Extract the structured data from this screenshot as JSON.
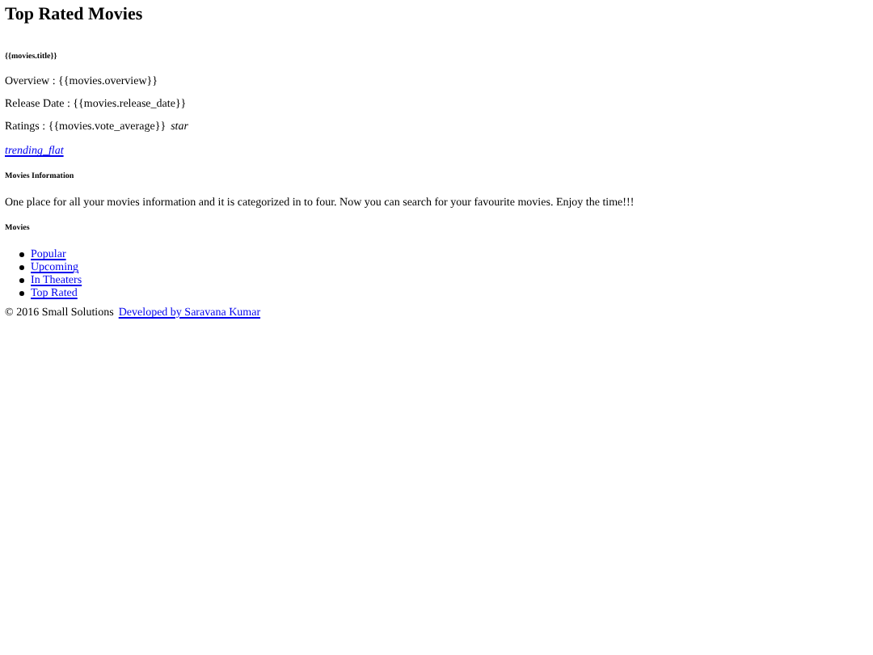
{
  "page_title": "Top Rated Movies",
  "movie": {
    "title": "{{movies.title}}",
    "overview": "Overview : {{movies.overview}}",
    "release_date": "Release Date : {{movies.release_date}}",
    "ratings": "Ratings : {{movies.vote_average}}",
    "ratings_icon": "star",
    "link": "trending_flat"
  },
  "info": {
    "heading": "Movies Information",
    "text": "One place for all your movies information and it is categorized in to four. Now you can search for your favourite movies. Enjoy the time!!!"
  },
  "nav": {
    "heading": "Movies",
    "items": [
      "Popular",
      "Upcoming",
      "In Theaters",
      "Top Rated"
    ]
  },
  "footer": {
    "copyright": "© 2016 Small Solutions",
    "credit_link": "Developed by Saravana Kumar"
  }
}
